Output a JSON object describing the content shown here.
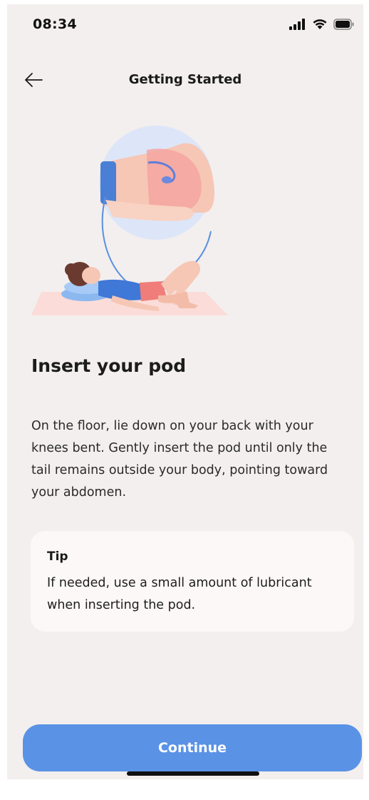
{
  "status_bar": {
    "time": "08:34",
    "icons": [
      "cellular-signal-icon",
      "wifi-icon",
      "battery-icon"
    ]
  },
  "nav": {
    "back_icon": "arrow-left-icon",
    "title": "Getting Started"
  },
  "illustration": {
    "subject": "woman lying on back with knees bent inserting pod, with inset close-up",
    "icon": "pod-insertion-illustration"
  },
  "content": {
    "heading": "Insert your pod",
    "body": "On the floor, lie down on your back with your knees bent. Gently insert the pod until only the tail remains outside your body, pointing toward your abdomen."
  },
  "tip": {
    "title": "Tip",
    "text": "If needed, use a small amount of lubricant when inserting the pod."
  },
  "actions": {
    "continue_label": "Continue"
  },
  "colors": {
    "background": "#f3efee",
    "card": "#fcf8f7",
    "accent": "#5a92e6",
    "text": "#1c1c1c"
  }
}
